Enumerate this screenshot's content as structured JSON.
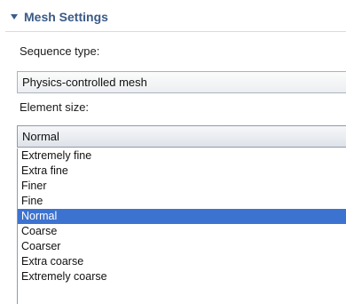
{
  "section": {
    "title": "Mesh Settings"
  },
  "sequence_type": {
    "label": "Sequence type:",
    "value": "Physics-controlled mesh"
  },
  "element_size": {
    "label": "Element size:",
    "value": "Normal",
    "options": [
      "Extremely fine",
      "Extra fine",
      "Finer",
      "Fine",
      "Normal",
      "Coarse",
      "Coarser",
      "Extra coarse",
      "Extremely coarse"
    ],
    "selected_index": 4
  },
  "colors": {
    "section_title": "#3a5a86",
    "selection_highlight": "#3d73d0"
  }
}
